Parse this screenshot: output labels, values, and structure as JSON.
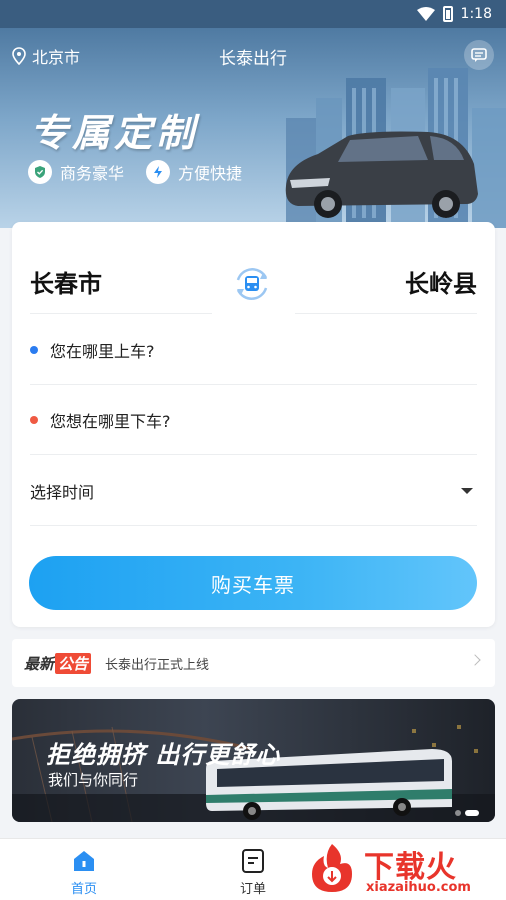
{
  "status_bar": {
    "time": "1:18",
    "wifi_icon": "wifi-icon",
    "battery_icon": "battery-icon"
  },
  "header": {
    "location": "北京市",
    "app_title": "长泰出行",
    "slogan": "专属定制",
    "badges": [
      {
        "label": "商务豪华",
        "icon": "shield-check-icon"
      },
      {
        "label": "方便快捷",
        "icon": "lightning-icon"
      }
    ]
  },
  "booking": {
    "from_city": "长春市",
    "to_city": "长岭县",
    "pickup_placeholder": "您在哪里上车?",
    "dropoff_placeholder": "您想在哪里下车?",
    "time_placeholder": "选择时间",
    "buy_button": "购买车票",
    "colors": {
      "pickup_dot": "#2b7cf0",
      "dropoff_dot": "#ef5a43",
      "accent": "#1da1f2"
    }
  },
  "notice": {
    "label_part1": "最新",
    "label_part2": "公告",
    "text": "长泰出行正式上线"
  },
  "promo": {
    "title": "拒绝拥挤 出行更舒心",
    "subtitle": "我们与你同行"
  },
  "bottom_nav": [
    {
      "label": "首页",
      "icon": "home-icon",
      "active": true
    },
    {
      "label": "订单",
      "icon": "orders-icon",
      "active": false
    }
  ],
  "watermark": {
    "title": "下载火",
    "url": "xiazaihuo.com"
  }
}
